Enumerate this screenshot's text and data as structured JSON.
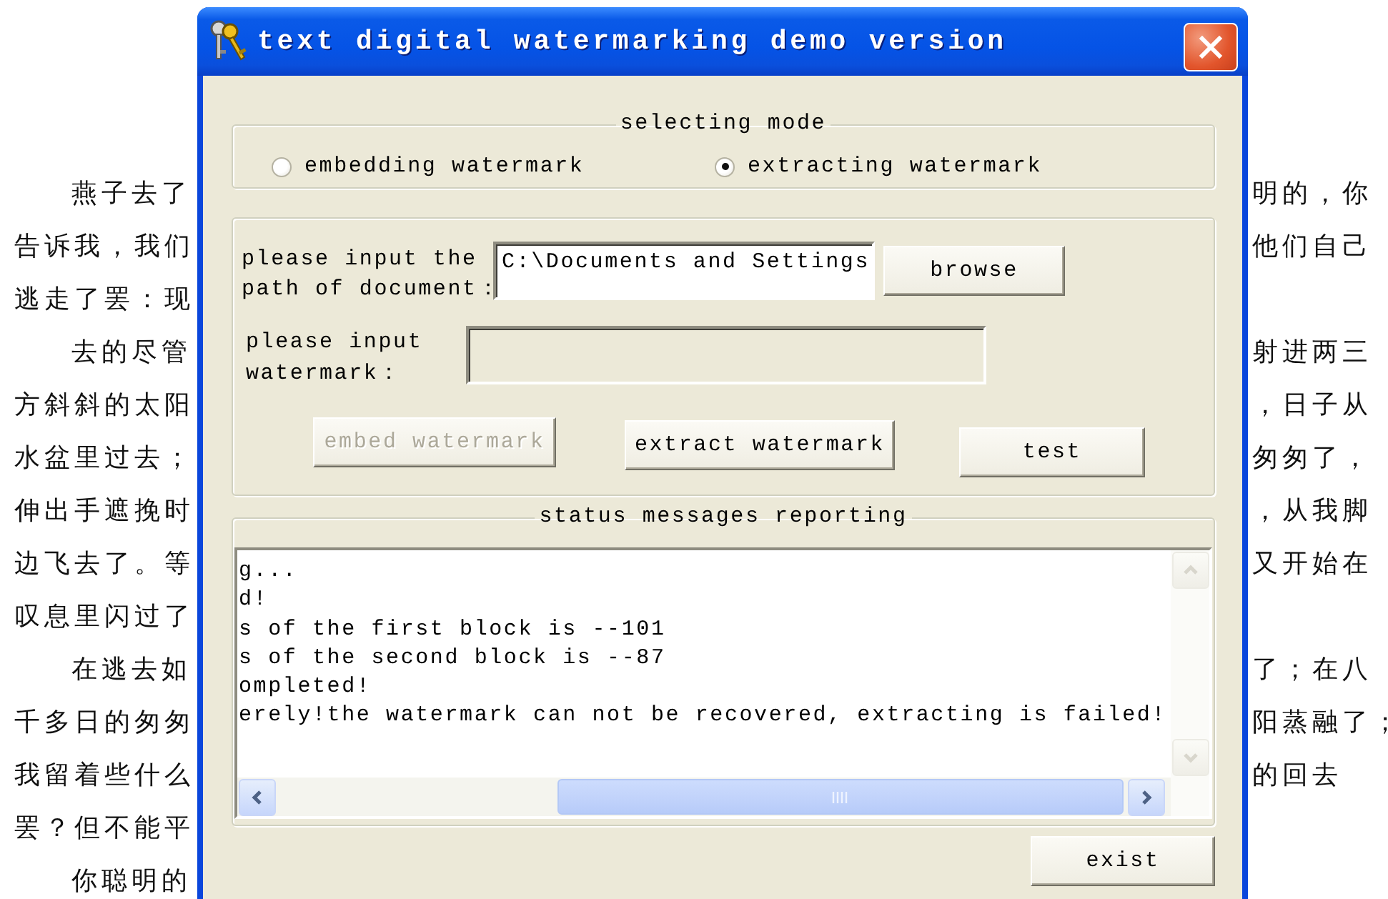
{
  "document": {
    "rows": [
      {
        "left": "燕子去了",
        "right": "明的，你",
        "paragraph_start": true
      },
      {
        "left": "告诉我，我们",
        "right": "他们自己",
        "paragraph_start": false
      },
      {
        "left": "逃走了罢：现",
        "paragraph_start": false
      },
      {
        "left": "去的尽管",
        "right": "射进两三",
        "paragraph_start": true
      },
      {
        "left": "方斜斜的太阳",
        "right": "，日子从",
        "paragraph_start": false
      },
      {
        "left": "水盆里过去；",
        "right": "匆匆了，",
        "paragraph_start": false
      },
      {
        "left": "伸出手遮挽时",
        "right": "，从我脚",
        "paragraph_start": false
      },
      {
        "left": "边飞去了。等",
        "right": "又开始在",
        "paragraph_start": false
      },
      {
        "left": "叹息里闪过了",
        "paragraph_start": false
      },
      {
        "left": "在逃去如",
        "right": "了；在八",
        "paragraph_start": true
      },
      {
        "left": "千多日的匆匆",
        "right": "阳蒸融了；",
        "paragraph_start": false
      },
      {
        "left": "我留着些什么",
        "right": "的回去",
        "paragraph_start": false
      },
      {
        "left": "罢？但不能平",
        "paragraph_start": false
      },
      {
        "left": "你聪明的",
        "paragraph_start": true
      }
    ]
  },
  "window": {
    "title": "text digital watermarking demo version"
  },
  "mode_group": {
    "legend": "selecting mode",
    "options": [
      {
        "label": "embedding watermark",
        "selected": false
      },
      {
        "label": "extracting watermark",
        "selected": true
      }
    ]
  },
  "input_group": {
    "document_label": "please input the\npath of document：",
    "document_path": "C:\\Documents and Settings",
    "browse_button": "browse",
    "watermark_label": "please input\nwatermark：",
    "watermark_field": {
      "disabled": true
    },
    "buttons": [
      {
        "label": "embed watermark",
        "disabled": true
      },
      {
        "label": "extract watermark",
        "disabled": false
      },
      {
        "label": "test",
        "disabled": false
      }
    ]
  },
  "status_group": {
    "legend": "status messages reporting",
    "lines": [
      "g...",
      "d!",
      "s of the first block is --101",
      "s of the second block is --87",
      "ompleted!",
      "erely!the watermark can not be recovered, extracting is failed!"
    ]
  },
  "exit_button": "exist"
}
